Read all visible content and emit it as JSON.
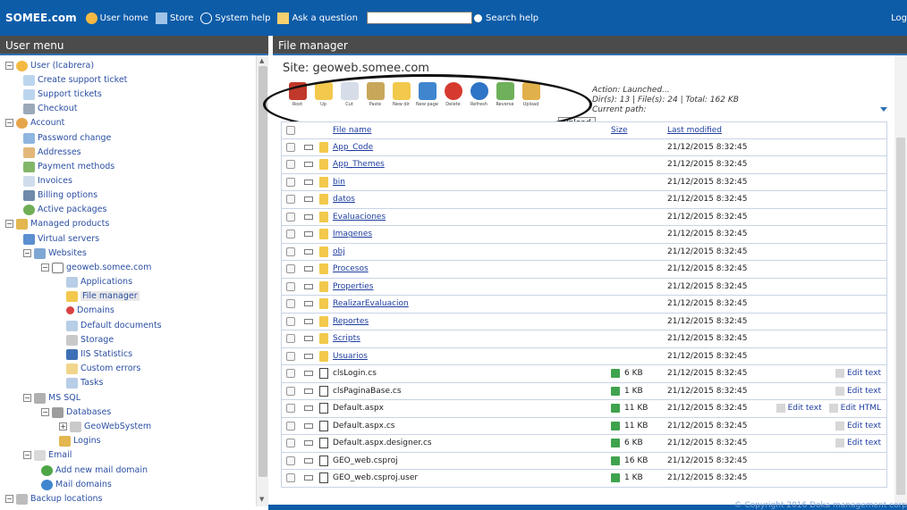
{
  "topbar": {
    "brand": "SOMEE.com",
    "user_home": "User home",
    "store": "Store",
    "system_help": "System help",
    "ask_question": "Ask a question",
    "search_help": "Search help",
    "logout": "Log"
  },
  "left": {
    "title": "User menu",
    "items": [
      "User (lcabrera)",
      "Create support ticket",
      "Support tickets",
      "Checkout",
      "Account",
      "Password change",
      "Addresses",
      "Payment methods",
      "Invoices",
      "Billing options",
      "Active packages",
      "Managed products",
      "Virtual servers",
      "Websites",
      "geoweb.somee.com",
      "Applications",
      "File manager",
      "Domains",
      "Default documents",
      "Storage",
      "IIS Statistics",
      "Custom errors",
      "Tasks",
      "MS SQL",
      "Databases",
      "GeoWebSystem",
      "Logins",
      "Email",
      "Add new mail domain",
      "Mail domains",
      "Backup locations"
    ]
  },
  "main": {
    "title": "File manager",
    "site": "Site: geoweb.somee.com",
    "toolbar": [
      "Root",
      "Up",
      "Cut",
      "Paste",
      "New dir",
      "New page",
      "Delete",
      "Refresh",
      "Reverse",
      "Upload"
    ],
    "info_line1": "Action: Launched...",
    "info_line2": "Dir(s): 13 | File(s): 24 | Total: 162 KB",
    "info_line3": "Current path:",
    "tooltip": "Upload",
    "columns": {
      "name": "File name",
      "size": "Size",
      "modified": "Last modified"
    },
    "rows": [
      {
        "name": "App_Code",
        "type": "folder",
        "size": "",
        "date": "21/12/2015 8:32:45",
        "actions": []
      },
      {
        "name": "App_Themes",
        "type": "folder",
        "size": "",
        "date": "21/12/2015 8:32:45",
        "actions": []
      },
      {
        "name": "bin",
        "type": "folder",
        "size": "",
        "date": "21/12/2015 8:32:45",
        "actions": []
      },
      {
        "name": "datos",
        "type": "folder",
        "size": "",
        "date": "21/12/2015 8:32:45",
        "actions": []
      },
      {
        "name": "Evaluaciones",
        "type": "folder",
        "size": "",
        "date": "21/12/2015 8:32:45",
        "actions": []
      },
      {
        "name": "Imagenes",
        "type": "folder",
        "size": "",
        "date": "21/12/2015 8:32:45",
        "actions": []
      },
      {
        "name": "obj",
        "type": "folder",
        "size": "",
        "date": "21/12/2015 8:32:45",
        "actions": []
      },
      {
        "name": "Procesos",
        "type": "folder",
        "size": "",
        "date": "21/12/2015 8:32:45",
        "actions": []
      },
      {
        "name": "Properties",
        "type": "folder",
        "size": "",
        "date": "21/12/2015 8:32:45",
        "actions": []
      },
      {
        "name": "RealizarEvaluacion",
        "type": "folder",
        "size": "",
        "date": "21/12/2015 8:32:45",
        "actions": []
      },
      {
        "name": "Reportes",
        "type": "folder",
        "size": "",
        "date": "21/12/2015 8:32:45",
        "actions": []
      },
      {
        "name": "Scripts",
        "type": "folder",
        "size": "",
        "date": "21/12/2015 8:32:45",
        "actions": []
      },
      {
        "name": "Usuarios",
        "type": "folder",
        "size": "",
        "date": "21/12/2015 8:32:45",
        "actions": []
      },
      {
        "name": "clsLogin.cs",
        "type": "file",
        "size": "6 KB",
        "date": "21/12/2015 8:32:45",
        "actions": [
          "Edit text"
        ]
      },
      {
        "name": "clsPaginaBase.cs",
        "type": "file",
        "size": "1 KB",
        "date": "21/12/2015 8:32:45",
        "actions": [
          "Edit text"
        ]
      },
      {
        "name": "Default.aspx",
        "type": "file",
        "size": "11 KB",
        "date": "21/12/2015 8:32:45",
        "actions": [
          "Edit text",
          "Edit HTML"
        ]
      },
      {
        "name": "Default.aspx.cs",
        "type": "file",
        "size": "11 KB",
        "date": "21/12/2015 8:32:45",
        "actions": [
          "Edit text"
        ]
      },
      {
        "name": "Default.aspx.designer.cs",
        "type": "file",
        "size": "6 KB",
        "date": "21/12/2015 8:32:45",
        "actions": [
          "Edit text"
        ]
      },
      {
        "name": "GEO_web.csproj",
        "type": "file",
        "size": "16 KB",
        "date": "21/12/2015 8:32:45",
        "actions": []
      },
      {
        "name": "GEO_web.csproj.user",
        "type": "file",
        "size": "1 KB",
        "date": "21/12/2015 8:32:45",
        "actions": []
      }
    ]
  },
  "footer": {
    "copyright": "© Copyright 2016 Doka management corp"
  }
}
